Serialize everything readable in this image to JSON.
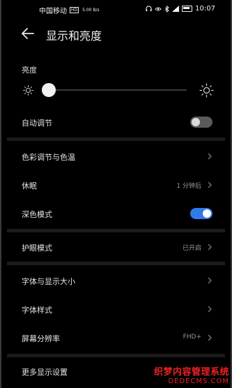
{
  "status_bar": {
    "carrier": "中国移动",
    "network_badge": "HD",
    "speed": "5.00 B/s",
    "time": "10:07",
    "icons": [
      "headphones-icon",
      "eye-icon",
      "bluetooth-icon",
      "signal-icon",
      "battery-icon"
    ]
  },
  "header": {
    "title": "显示和亮度",
    "back_icon": "back-arrow-icon"
  },
  "brightness": {
    "label": "亮度",
    "level": 0.02
  },
  "rows": {
    "auto_adjust": {
      "label": "自动调节",
      "toggle_on": false
    },
    "color": {
      "label": "色彩调节与色温"
    },
    "sleep": {
      "label": "休眠",
      "value": "1 分钟后"
    },
    "dark_mode": {
      "label": "深色模式",
      "toggle_on": true
    },
    "eye_comfort": {
      "label": "护眼模式",
      "value": "已开启"
    },
    "font_display_size": {
      "label": "字体与显示大小"
    },
    "font_style": {
      "label": "字体样式"
    },
    "resolution": {
      "label": "屏幕分辨率",
      "value": "FHD+"
    },
    "more": {
      "label": "更多显示设置"
    }
  },
  "colors": {
    "accent": "#2f7bea",
    "background": "#000000",
    "card_separator": "#1b1b1b"
  },
  "watermark": {
    "line1": "织梦内容管理系统",
    "line2": "DEDECMS.COM"
  }
}
